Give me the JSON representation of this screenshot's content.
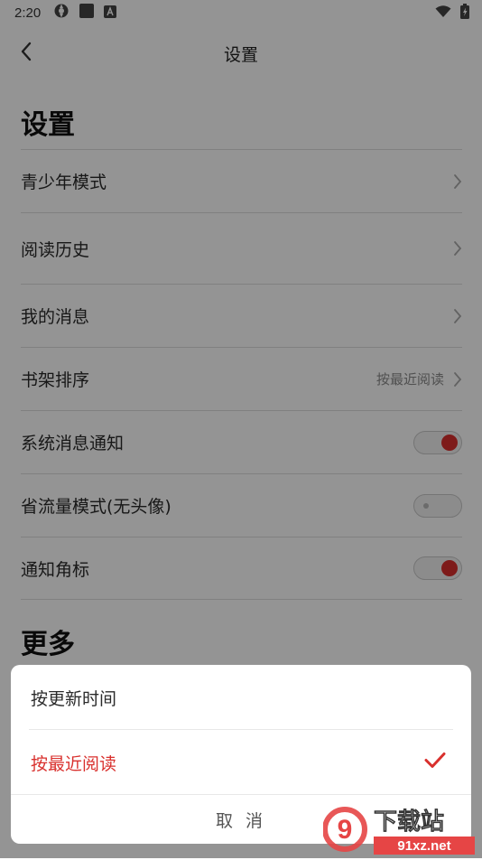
{
  "status_bar": {
    "time": "2:20"
  },
  "header": {
    "title": "设置"
  },
  "settings_section": {
    "title": "设置",
    "items": [
      {
        "label": "青少年模式",
        "type": "chevron"
      },
      {
        "label": "阅读历史",
        "type": "chevron"
      },
      {
        "label": "我的消息",
        "type": "chevron"
      },
      {
        "label": "书架排序",
        "type": "chevron",
        "value": "按最近阅读"
      },
      {
        "label": "系统消息通知",
        "type": "toggle",
        "on": true
      },
      {
        "label": "省流量模式(无头像)",
        "type": "toggle",
        "on": false
      },
      {
        "label": "通知角标",
        "type": "toggle",
        "on": true
      }
    ]
  },
  "more_section": {
    "title": "更多"
  },
  "sort_sheet": {
    "options": [
      {
        "label": "按更新时间",
        "selected": false
      },
      {
        "label": "按最近阅读",
        "selected": true
      }
    ],
    "cancel_label": "取 消"
  },
  "watermark": {
    "logo_text": "9",
    "site_name": "下载站",
    "domain": "91xz.net"
  },
  "colors": {
    "accent": "#d9302d",
    "overlay": "rgba(0,0,0,0.42)"
  }
}
